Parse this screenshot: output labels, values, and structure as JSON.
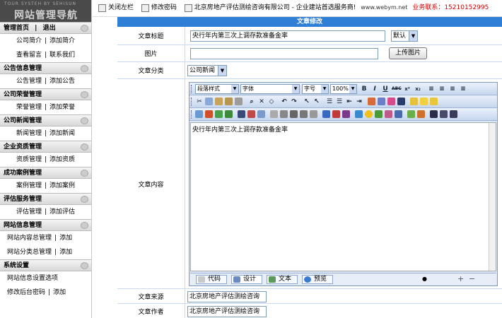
{
  "sidebar": {
    "logo_tagline": "TOUR SYSTEH BY SEHISUN",
    "logo_title": "网站管理导航",
    "top": {
      "home": "管理首页",
      "sep": "|",
      "logout": "退出"
    },
    "sections": [
      {
        "head": null,
        "rows": [
          [
            "公司简介",
            "添加简介"
          ],
          [
            "查看留言",
            "联系我们"
          ]
        ]
      },
      {
        "head": "公告信息管理",
        "rows": [
          [
            "公告管理",
            "添加公告"
          ]
        ]
      },
      {
        "head": "公司荣誉管理",
        "rows": [
          [
            "荣誉管理",
            "添加荣誉"
          ]
        ]
      },
      {
        "head": "公司新闻管理",
        "rows": [
          [
            "新闻管理",
            "添加新闻"
          ]
        ]
      },
      {
        "head": "企业资质管理",
        "rows": [
          [
            "资质管理",
            "添加资质"
          ]
        ]
      },
      {
        "head": "成功案例管理",
        "rows": [
          [
            "案例管理",
            "添加案例"
          ]
        ]
      },
      {
        "head": "评估服务管理",
        "rows": [
          [
            "评估管理",
            "添加评估"
          ]
        ]
      },
      {
        "head": "网站信息管理",
        "rows": [
          [
            "网站内容总管理",
            "添加"
          ],
          [
            "网站分类总管理",
            "添加"
          ]
        ]
      },
      {
        "head": "系统设置",
        "rows": [
          [
            "网站信息设置选项"
          ],
          [
            "修改后台密码",
            "添加"
          ]
        ]
      }
    ]
  },
  "topbar": {
    "close_sidebar": "关闭左栏",
    "change_password": "修改密码",
    "company": "北京房地产评估测绘咨询有限公司 - 企业建站首选服务商!",
    "url": "www.webym.net",
    "phone": "业务联系：15210152995"
  },
  "form": {
    "caption": "文章修改",
    "title_label": "文章标题",
    "title_value": "央行年内第三次上调存款准备金率",
    "title_style": "默认",
    "image_label": "图片",
    "image_value": "",
    "upload_button": "上传图片",
    "category_label": "文章分类",
    "category_value": "公司新闻",
    "content_label": "文章内容",
    "content_value": "央行年内第三次上调存款准备金率",
    "source_label": "文章来源",
    "source_value": "北京房地产评估测绘咨询",
    "author_label": "文章作者",
    "author_value": "北京房地产评估测绘咨询"
  },
  "editor": {
    "paragraph_style": "段落样式",
    "font": "字体",
    "size": "字号",
    "zoom": "100%",
    "modes": [
      "代码",
      "设计",
      "文本",
      "预览"
    ]
  }
}
